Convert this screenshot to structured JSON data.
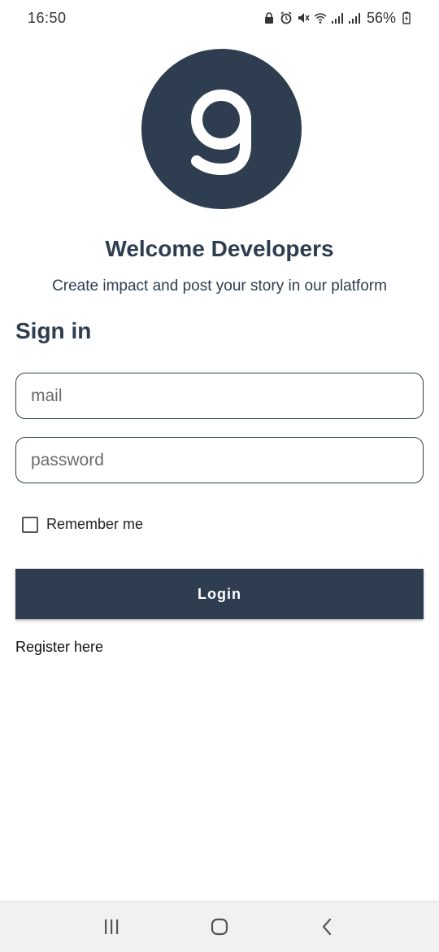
{
  "status_bar": {
    "time": "16:50",
    "battery": "56%",
    "icons": [
      "lock-icon",
      "alarm-icon",
      "mute-icon",
      "wifi-icon",
      "signal-icon",
      "signal-icon",
      "battery-charging-icon"
    ]
  },
  "logo": {
    "glyph": "9",
    "icon": "app-logo-icon",
    "background": "#2e3e50"
  },
  "welcome": {
    "title": "Welcome Developers",
    "subtitle": "Create impact and post your story in our platform"
  },
  "signin": {
    "heading": "Sign in",
    "mail_placeholder": "mail",
    "mail_value": "",
    "password_placeholder": "password",
    "password_value": "",
    "remember_label": "Remember me",
    "remember_checked": false,
    "login_label": "Login",
    "register_label": "Register here"
  },
  "nav_bar": {
    "icons": [
      "recent-apps-icon",
      "home-icon",
      "back-icon"
    ]
  },
  "colors": {
    "primary": "#2e3e50",
    "background": "#ffffff",
    "nav_background": "#f1f1f1"
  }
}
